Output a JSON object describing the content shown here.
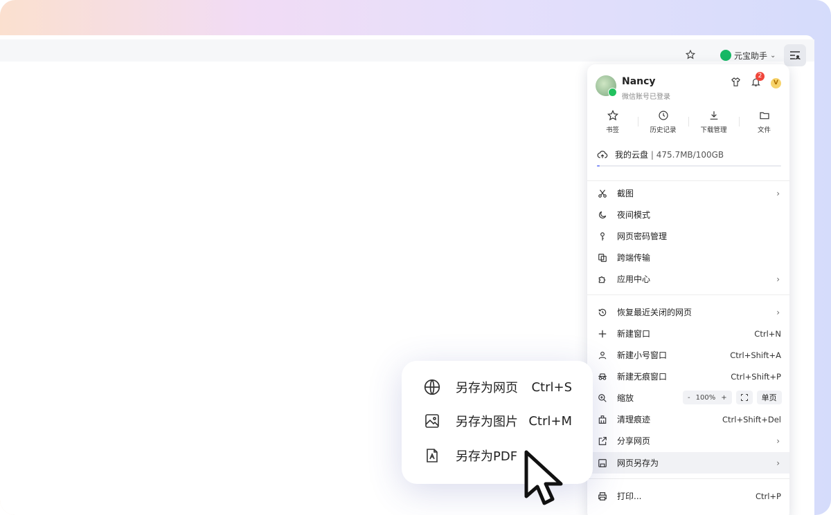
{
  "toolbar": {
    "assistant_label": "元宝助手"
  },
  "profile": {
    "name": "Nancy",
    "status": "微信账号已登录",
    "notification_count": "2",
    "vip_label": "V"
  },
  "quick_actions": [
    {
      "label": "书签",
      "icon": "star-icon"
    },
    {
      "label": "历史记录",
      "icon": "clock-icon"
    },
    {
      "label": "下载管理",
      "icon": "download-icon"
    },
    {
      "label": "文件",
      "icon": "folder-icon"
    }
  ],
  "cloud": {
    "label": "我的云盘",
    "sep": "|",
    "usage": "475.7MB/100GB",
    "fill_fraction": 0.005
  },
  "menu": {
    "screenshot": "截图",
    "night_mode": "夜间模式",
    "password_manager": "网页密码管理",
    "cross_device": "跨端传输",
    "app_center": "应用中心",
    "restore_closed": "恢复最近关闭的网页",
    "new_window": "新建窗口",
    "new_window_sc": "Ctrl+N",
    "new_small_window": "新建小号窗口",
    "new_small_window_sc": "Ctrl+Shift+A",
    "new_incognito": "新建无痕窗口",
    "new_incognito_sc": "Ctrl+Shift+P",
    "zoom": "缩放",
    "zoom_minus": "-",
    "zoom_value": "100%",
    "zoom_plus": "+",
    "single_page": "单页",
    "clear_traces": "清理痕迹",
    "clear_traces_sc": "Ctrl+Shift+Del",
    "share_page": "分享网页",
    "save_page_as": "网页另存为",
    "print": "打印...",
    "print_sc": "Ctrl+P"
  },
  "submenu": [
    {
      "label": "另存为网页",
      "shortcut": "Ctrl+S",
      "icon": "globe-icon"
    },
    {
      "label": "另存为图片",
      "shortcut": "Ctrl+M",
      "icon": "image-icon"
    },
    {
      "label": "另存为PDF",
      "shortcut": "",
      "icon": "pdf-icon"
    }
  ],
  "colors": {
    "accent": "#7e8cf8",
    "badge": "#f0463b",
    "wechat_green": "#22c15e"
  }
}
